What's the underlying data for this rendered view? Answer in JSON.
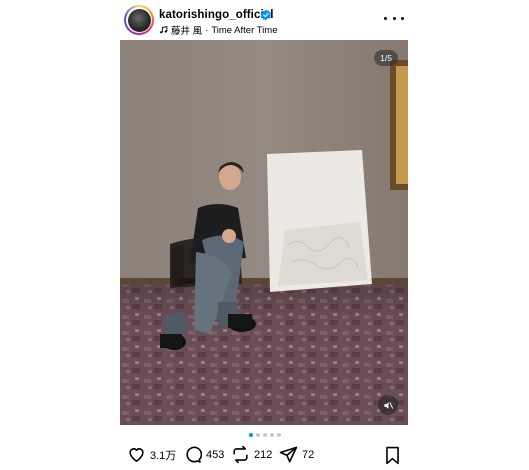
{
  "header": {
    "username": "katorishingo_official",
    "verified": true,
    "music_artist": "藤井 風",
    "music_separator": "·",
    "music_track": "Time After Time",
    "more_icon": "more-horizontal-icon"
  },
  "media": {
    "counter": "1/5",
    "mute_icon": "speaker-muted-icon",
    "carousel_total": 5,
    "carousel_active": 1
  },
  "actions": {
    "likes": "3.1万",
    "comments": "453",
    "reposts": "212",
    "shares": "72"
  },
  "colors": {
    "verified_blue": "#0095f6",
    "active_dot": "#0095f6"
  }
}
